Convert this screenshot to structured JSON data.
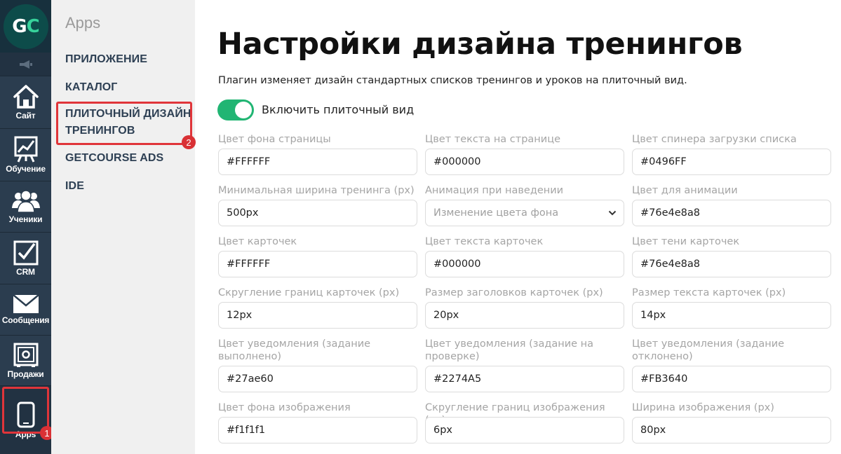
{
  "app": {
    "logo_text_g": "G",
    "logo_text_c": "C",
    "logo_colors": {
      "circle": "#0d4c4a",
      "c_letter": "#37d29b"
    }
  },
  "leftnav": {
    "items": [
      {
        "label": "Сайт",
        "icon": "home-icon"
      },
      {
        "label": "Обучение",
        "icon": "chart-board-icon"
      },
      {
        "label": "Ученики",
        "icon": "users-icon"
      },
      {
        "label": "CRM",
        "icon": "checkbox-icon"
      },
      {
        "label": "Сообщения",
        "icon": "envelope-icon"
      },
      {
        "label": "Продажи",
        "icon": "safe-icon"
      },
      {
        "label": "Apps",
        "icon": "phone-icon"
      }
    ],
    "badge": "1"
  },
  "sidebar": {
    "title": "Apps",
    "items": [
      {
        "label": "ПРИЛОЖЕНИЕ"
      },
      {
        "label": "КАТАЛОГ"
      },
      {
        "label_line1": "ПЛИТОЧНЫЙ ДИЗАЙН",
        "label_line2": "ТРЕНИНГОВ"
      },
      {
        "label": "GETCOURSE ADS"
      },
      {
        "label": "IDE"
      }
    ],
    "badge": "2"
  },
  "main": {
    "title": "Настройки дизайна тренингов",
    "description": "Плагин изменяет дизайн стандартных списков тренингов и уроков на плиточный вид.",
    "toggle": {
      "label": "Включить плиточный вид",
      "on": true,
      "color": "#21b573"
    },
    "fields": [
      {
        "label": "Цвет фона страницы",
        "value": "#FFFFFF"
      },
      {
        "label": "Цвет текста на странице",
        "value": "#000000"
      },
      {
        "label": "Цвет спинера загрузки списка",
        "value": "#0496FF"
      },
      {
        "label": "Минимальная ширина тренинга (px)",
        "value": "500px"
      },
      {
        "label": "Анимация при наведении",
        "value": "Изменение цвета фона",
        "type": "select"
      },
      {
        "label": "Цвет для анимации",
        "value": "#76e4e8a8"
      },
      {
        "label": "Цвет карточек",
        "value": "#FFFFFF"
      },
      {
        "label": "Цвет текста карточек",
        "value": "#000000"
      },
      {
        "label": "Цвет тени карточек",
        "value": "#76e4e8a8"
      },
      {
        "label": "Скругление границ карточек (px)",
        "value": "12px"
      },
      {
        "label": "Размер заголовков карточек (px)",
        "value": "20px"
      },
      {
        "label": "Размер текста карточек (px)",
        "value": "14px"
      },
      {
        "label_line1": "Цвет уведомления (задание",
        "label_line2": "выполнено)",
        "value": "#27ae60"
      },
      {
        "label_line1": "Цвет уведомления (задание на",
        "label_line2": "проверке)",
        "value": "#2274A5"
      },
      {
        "label_line1": "Цвет уведомления (задание",
        "label_line2": "отклонено)",
        "value": "#FB3640"
      },
      {
        "label": "Цвет фона изображения",
        "value": "#f1f1f1"
      },
      {
        "label": "Скругление границ изображения (px)",
        "value": "6px"
      },
      {
        "label": "Ширина изображения (px)",
        "value": "80px"
      }
    ]
  },
  "highlight_color": "#e0353a"
}
